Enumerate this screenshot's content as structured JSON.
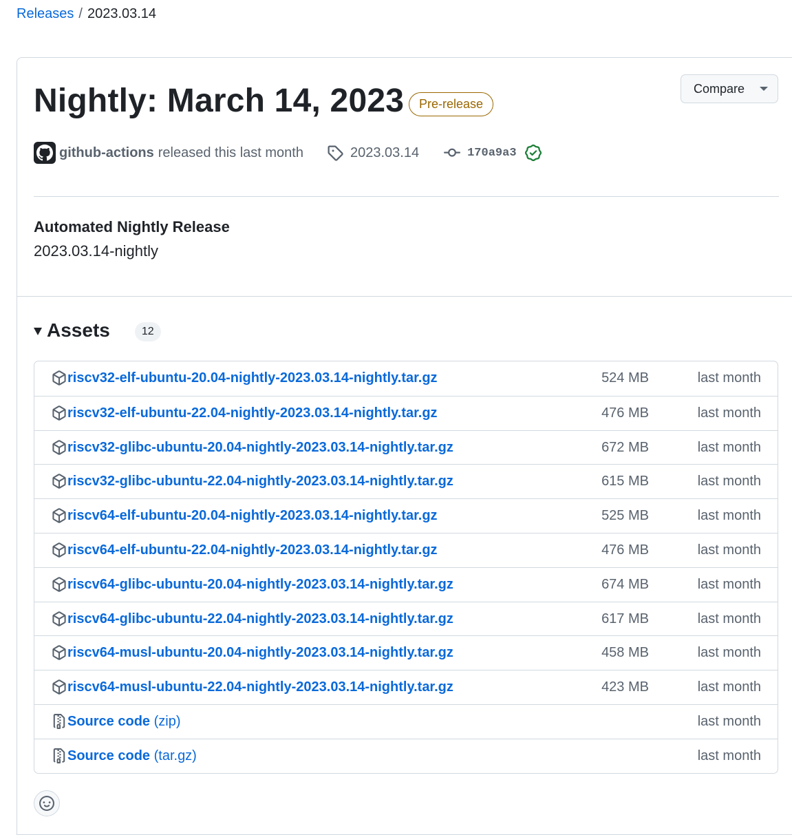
{
  "breadcrumb": {
    "parent": "Releases",
    "separator": "/",
    "current": "2023.03.14"
  },
  "release": {
    "title": "Nightly: March 14, 2023",
    "badge": "Pre-release",
    "compare_label": "Compare",
    "author": "github-actions",
    "released_text": "released this last month",
    "tag": "2023.03.14",
    "commit": "170a9a3",
    "body_title": "Automated Nightly Release",
    "body_text": "2023.03.14-nightly"
  },
  "assets": {
    "title": "Assets",
    "count": "12",
    "items": [
      {
        "name": "riscv32-elf-ubuntu-20.04-nightly-2023.03.14-nightly.tar.gz",
        "size": "524 MB",
        "date": "last month"
      },
      {
        "name": "riscv32-elf-ubuntu-22.04-nightly-2023.03.14-nightly.tar.gz",
        "size": "476 MB",
        "date": "last month"
      },
      {
        "name": "riscv32-glibc-ubuntu-20.04-nightly-2023.03.14-nightly.tar.gz",
        "size": "672 MB",
        "date": "last month"
      },
      {
        "name": "riscv32-glibc-ubuntu-22.04-nightly-2023.03.14-nightly.tar.gz",
        "size": "615 MB",
        "date": "last month"
      },
      {
        "name": "riscv64-elf-ubuntu-20.04-nightly-2023.03.14-nightly.tar.gz",
        "size": "525 MB",
        "date": "last month"
      },
      {
        "name": "riscv64-elf-ubuntu-22.04-nightly-2023.03.14-nightly.tar.gz",
        "size": "476 MB",
        "date": "last month"
      },
      {
        "name": "riscv64-glibc-ubuntu-20.04-nightly-2023.03.14-nightly.tar.gz",
        "size": "674 MB",
        "date": "last month"
      },
      {
        "name": "riscv64-glibc-ubuntu-22.04-nightly-2023.03.14-nightly.tar.gz",
        "size": "617 MB",
        "date": "last month"
      },
      {
        "name": "riscv64-musl-ubuntu-20.04-nightly-2023.03.14-nightly.tar.gz",
        "size": "458 MB",
        "date": "last month"
      },
      {
        "name": "riscv64-musl-ubuntu-22.04-nightly-2023.03.14-nightly.tar.gz",
        "size": "423 MB",
        "date": "last month"
      },
      {
        "name": "Source code",
        "suffix": "(zip)",
        "date": "last month"
      },
      {
        "name": "Source code",
        "suffix": "(tar.gz)",
        "date": "last month"
      }
    ]
  },
  "colors": {
    "link": "#0969da",
    "prerelease": "#9a6700",
    "verified": "#1a7f37",
    "muted": "#59636e"
  },
  "icons": {
    "package": "package-icon",
    "zip": "file-zip-icon",
    "tag": "tag-icon",
    "commit": "git-commit-icon",
    "verified": "verified-icon",
    "smiley": "smiley-icon",
    "caret": "triangle-down-icon"
  }
}
